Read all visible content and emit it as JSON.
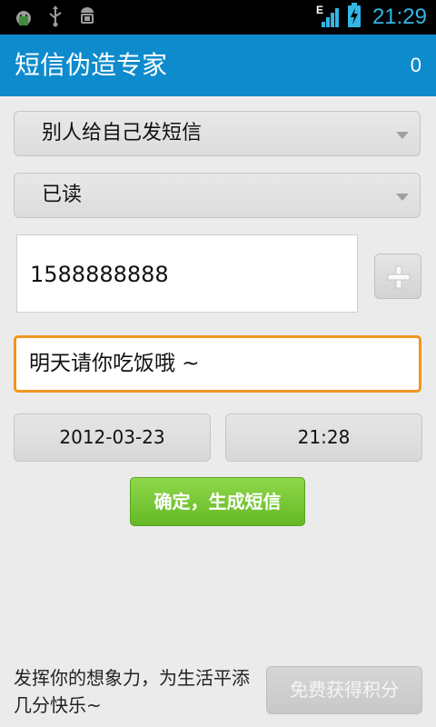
{
  "status_bar": {
    "time": "21:29",
    "network_type": "E",
    "icons": [
      "android-debug-icon",
      "usb-icon",
      "android-icon",
      "signal-icon",
      "battery-charging-icon"
    ],
    "accent": "#33b5e5"
  },
  "action_bar": {
    "title": "短信伪造专家",
    "credit": "0",
    "background": "#0e8bcc"
  },
  "form": {
    "sender_mode": "别人给自己发短信",
    "read_state": "已读",
    "phone_number": "1588888888",
    "message": "明天请你吃饭哦 ~",
    "date": "2012-03-23",
    "time": "21:28",
    "confirm_label": "确定，生成短信",
    "add_contact_icon": "plus-icon"
  },
  "footer": {
    "tagline": "发挥你的想象力，为生活平添几分快乐~",
    "free_points_label": "免费获得积分"
  }
}
